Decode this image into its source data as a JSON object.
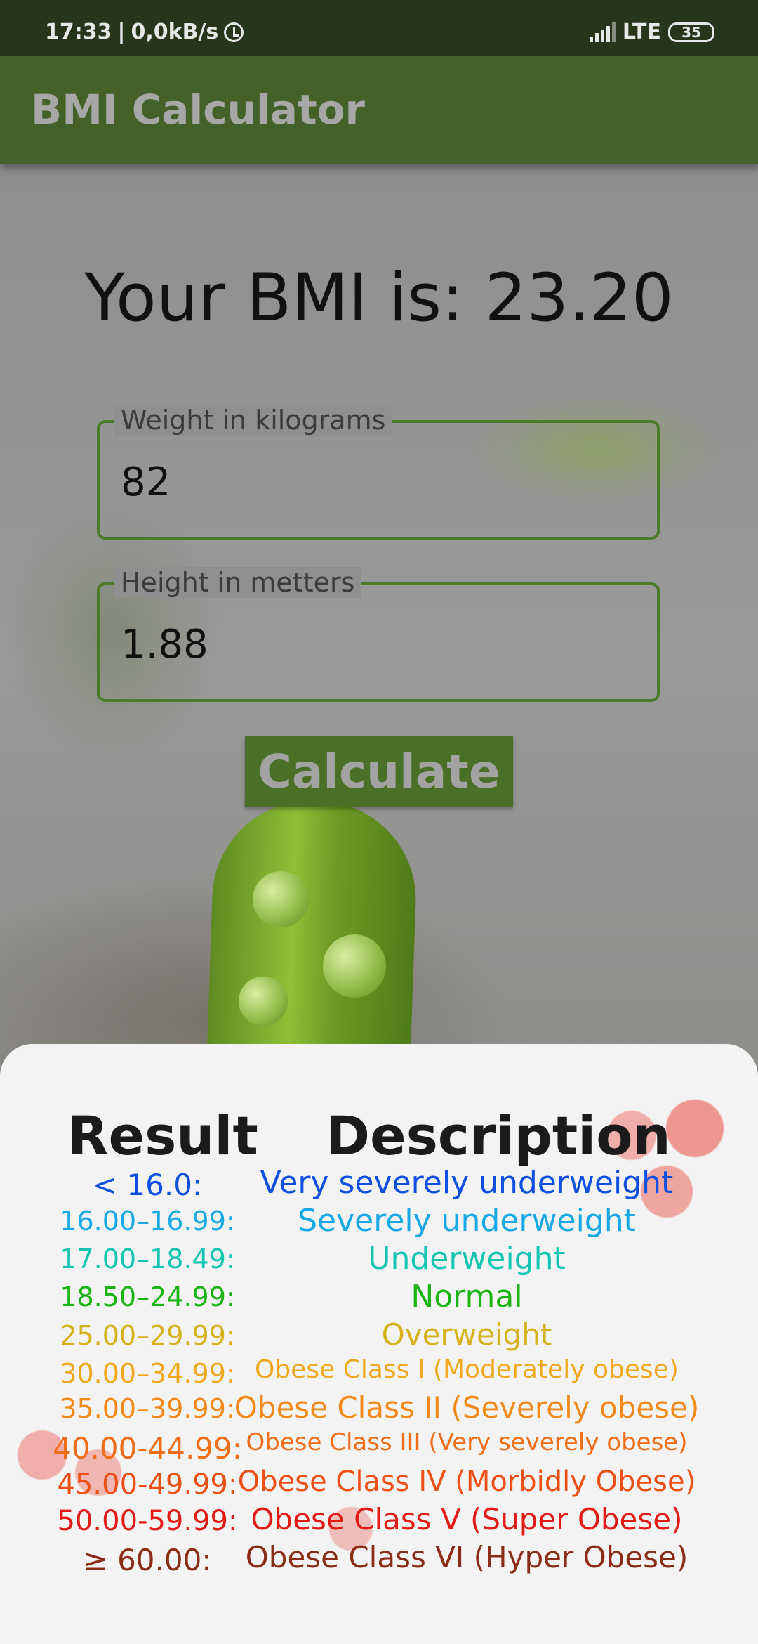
{
  "status_bar": {
    "time": "17:33",
    "separator": "|",
    "speed": "0,0kB/s",
    "network": "LTE",
    "battery": "35",
    "icons": [
      "alarm-icon",
      "signal-icon",
      "battery-icon"
    ]
  },
  "app_bar": {
    "title": "BMI Calculator"
  },
  "bmi_result": "Your BMI is: 23.20",
  "weight_field": {
    "label": "Weight in kilograms",
    "value": "82"
  },
  "height_field": {
    "label": "Height in metters",
    "value": "1.88"
  },
  "calculate_button": "Calculate",
  "table": {
    "headers": {
      "result": "Result",
      "description": "Description"
    },
    "rows": [
      {
        "result": "< 16.0:",
        "description": "Very severely underweight",
        "color": "#0e4fe0"
      },
      {
        "result": "16.00–16.99:",
        "description": "Severely underweight",
        "color": "#17a9e6"
      },
      {
        "result": "17.00–18.49:",
        "description": "Underweight",
        "color": "#14c6b2"
      },
      {
        "result": "18.50–24.99:",
        "description": "Normal",
        "color": "#19b412"
      },
      {
        "result": "25.00–29.99:",
        "description": "Overweight",
        "color": "#d6b21a"
      },
      {
        "result": "30.00–34.99:",
        "description": "Obese Class I (Moderately obese)",
        "color": "#f0a81b"
      },
      {
        "result": "35.00–39.99:",
        "description": "Obese Class II (Severely obese)",
        "color": "#f28a1a"
      },
      {
        "result": "40.00-44.99:",
        "description": "Obese Class III (Very severely obese)",
        "color": "#f06e18"
      },
      {
        "result": "45.00-49.99:",
        "description": "Obese Class IV (Morbidly Obese)",
        "color": "#ee4f15"
      },
      {
        "result": "50.00-59.99:",
        "description": "Obese Class V (Super Obese)",
        "color": "#e21b17"
      },
      {
        "result": "≥ 60.00:",
        "description": "Obese Class VI (Hyper Obese)",
        "color": "#8b2d16"
      }
    ]
  },
  "colors": {
    "app_bar": "#44612a",
    "status_bar": "#27351a",
    "accent": "#4c7a28"
  }
}
